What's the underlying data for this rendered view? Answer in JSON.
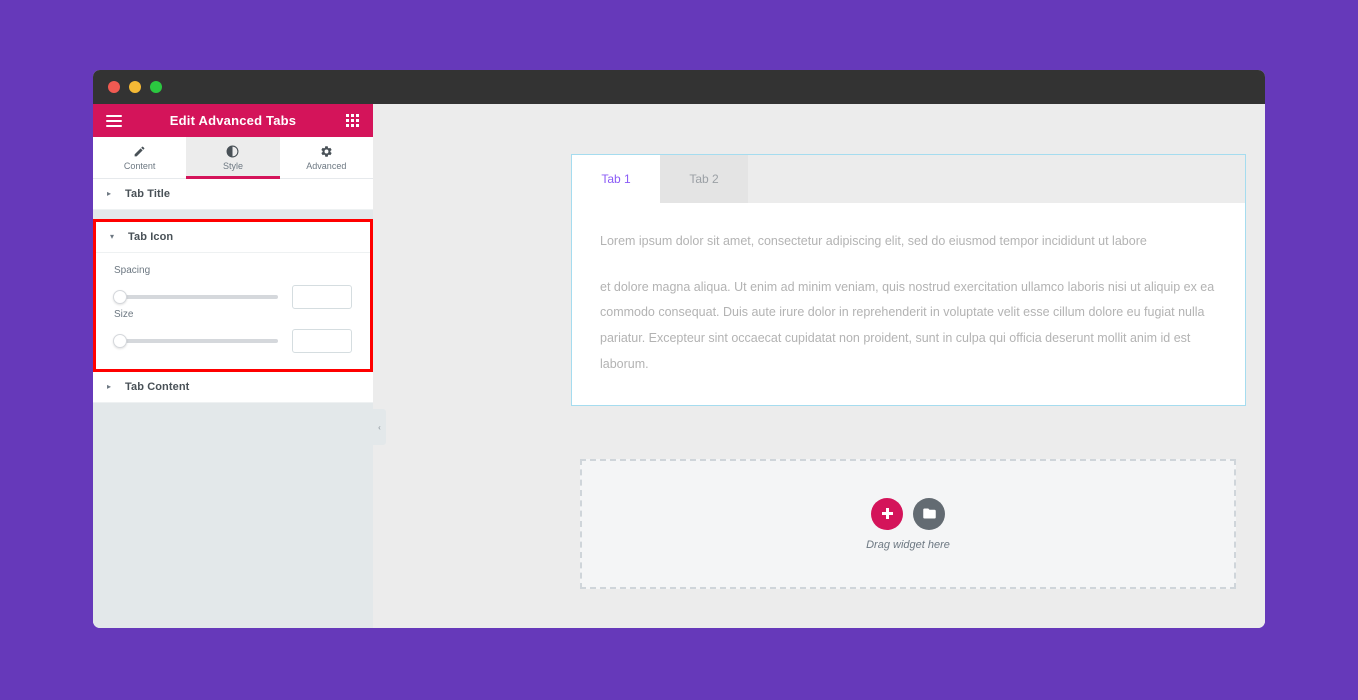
{
  "window": {
    "traffic_lights": [
      "close",
      "minimize",
      "maximize"
    ]
  },
  "panel": {
    "header": {
      "title": "Edit Advanced Tabs",
      "menu_icon": "hamburger-icon",
      "grid_icon": "grid-icon"
    },
    "tabs": [
      {
        "label": "Content",
        "icon": "pencil-icon",
        "active": false
      },
      {
        "label": "Style",
        "icon": "contrast-icon",
        "active": true
      },
      {
        "label": "Advanced",
        "icon": "gear-icon",
        "active": false
      }
    ],
    "sections": [
      {
        "label": "Tab Title",
        "expanded": false,
        "arrow": "▸"
      },
      {
        "label": "Tab Icon",
        "expanded": true,
        "arrow": "▾"
      },
      {
        "label": "Tab Content",
        "expanded": false,
        "arrow": "▸"
      }
    ],
    "tab_icon_controls": [
      {
        "label": "Spacing",
        "value": "",
        "slider_position": 0
      },
      {
        "label": "Size",
        "value": "",
        "slider_position": 0
      }
    ],
    "collapse_handle": "‹",
    "highlight_color": "#ff0000"
  },
  "canvas": {
    "tabs_widget": {
      "tabs": [
        {
          "label": "Tab 1",
          "active": true
        },
        {
          "label": "Tab 2",
          "active": false
        }
      ],
      "paragraphs": [
        "Lorem ipsum dolor sit amet, consectetur adipiscing elit, sed do eiusmod tempor incididunt ut labore",
        "et dolore magna aliqua. Ut enim ad minim veniam, quis nostrud exercitation ullamco laboris nisi ut aliquip ex ea commodo consequat. Duis aute irure dolor in reprehenderit in voluptate velit esse cillum dolore eu fugiat nulla pariatur. Excepteur sint occaecat cupidatat non proident, sunt in culpa qui officia deserunt mollit anim id est laborum."
      ],
      "active_tab_color": "#8b5cf6",
      "border_color": "#a5dcef"
    },
    "dropzone": {
      "label": "Drag widget here",
      "add_icon": "plus-icon",
      "folder_icon": "folder-icon"
    }
  },
  "colors": {
    "background": "#6639ba",
    "panel_header": "#d4145a",
    "accent": "#d4145a"
  }
}
